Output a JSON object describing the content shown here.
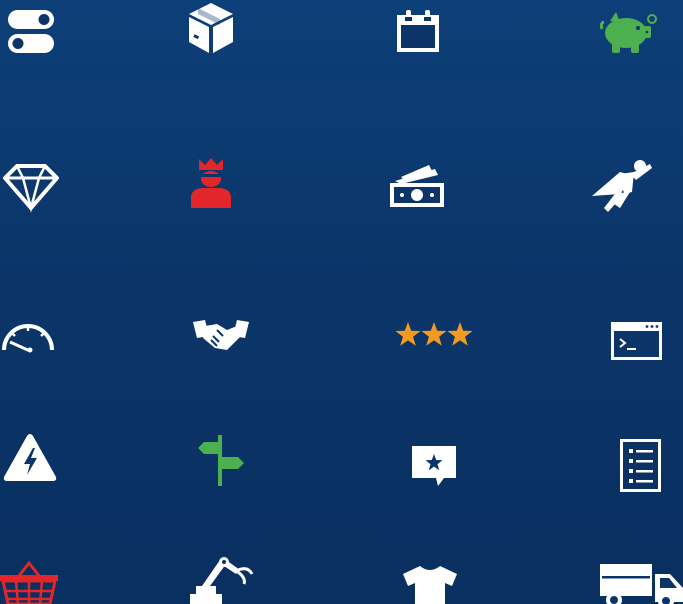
{
  "background_color": "#0b3569",
  "icon_colors": {
    "white": "#ffffff",
    "green": "#4caf50",
    "red": "#e3262a",
    "orange": "#f39a21"
  },
  "icons": [
    "toggle-switches-icon",
    "package-box-icon",
    "calendar-icon",
    "piggy-bank-icon",
    "diamond-icon",
    "king-user-icon",
    "money-bills-icon",
    "superhero-icon",
    "speedometer-icon",
    "handshake-icon",
    "three-stars-icon",
    "terminal-window-icon",
    "high-voltage-warning-icon",
    "signpost-icon",
    "star-chat-bubble-icon",
    "checklist-icon",
    "shopping-basket-icon",
    "robot-arm-icon",
    "t-shirt-icon",
    "delivery-truck-icon"
  ]
}
